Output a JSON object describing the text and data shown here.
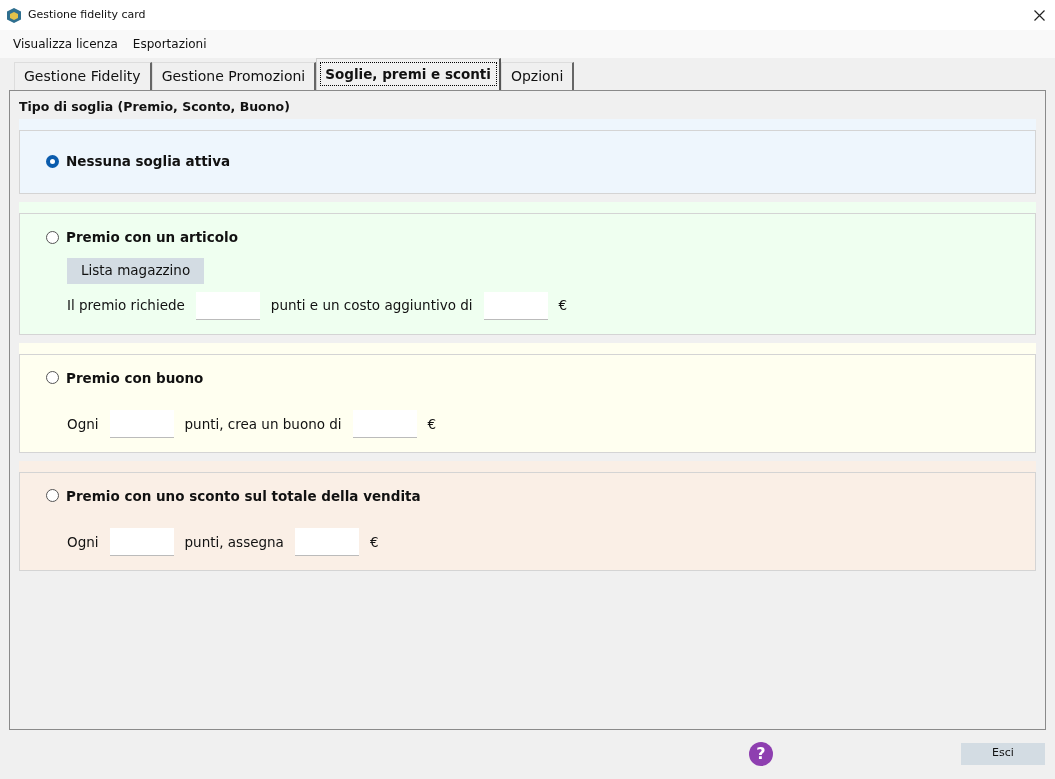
{
  "window": {
    "title": "Gestione fidelity card"
  },
  "menu": [
    "Visualizza licenza",
    "Esportazioni"
  ],
  "tabs": [
    {
      "label": "Gestione Fidelity",
      "selected": false
    },
    {
      "label": "Gestione Promozioni",
      "selected": false
    },
    {
      "label": "Soglie, premi e sconti",
      "selected": true
    },
    {
      "label": "Opzioni",
      "selected": false
    }
  ],
  "group_title": "Tipo di soglia (Premio, Sconto, Buono)",
  "options": [
    {
      "label": "Nessuna soglia attiva",
      "selected": true,
      "color": "#eef6fd"
    },
    {
      "label": "Premio con un articolo",
      "selected": false,
      "color": "#effff0",
      "button": "Lista magazzino",
      "rows": [
        [
          {
            "kind": "text",
            "text": "Il premio richiede"
          },
          {
            "kind": "field"
          },
          {
            "kind": "text",
            "text": "punti e un costo aggiuntivo di"
          },
          {
            "kind": "field"
          },
          {
            "kind": "text",
            "text": "€"
          }
        ]
      ]
    },
    {
      "label": "Premio con buono",
      "selected": false,
      "color": "#fffff0",
      "rows": [
        [
          {
            "kind": "text",
            "text": "Ogni"
          },
          {
            "kind": "field"
          },
          {
            "kind": "text",
            "text": "punti, crea un buono di"
          },
          {
            "kind": "field"
          },
          {
            "kind": "text",
            "text": "€"
          }
        ]
      ]
    },
    {
      "label": "Premio con uno sconto sul totale della vendita",
      "selected": false,
      "color": "#faefe6",
      "rows": [
        [
          {
            "kind": "text",
            "text": "Ogni"
          },
          {
            "kind": "field"
          },
          {
            "kind": "text",
            "text": "punti, assegna"
          },
          {
            "kind": "field"
          },
          {
            "kind": "text",
            "text": "€"
          }
        ]
      ]
    }
  ],
  "help_button": {
    "label": "?"
  },
  "exit_button": {
    "label": "Esci"
  }
}
